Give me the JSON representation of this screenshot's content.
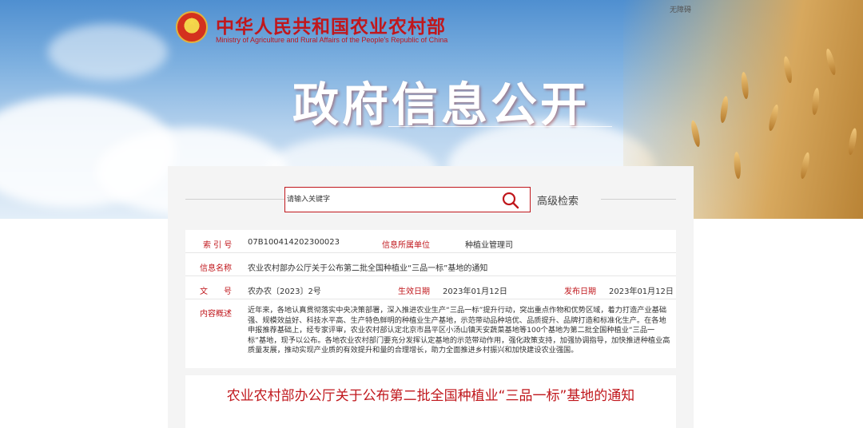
{
  "header": {
    "ministry_cn": "中华人民共和国农业农村部",
    "ministry_en": "Ministry of Agriculture and Rural Affairs of the People's Republic of China",
    "accessibility": "无障碍",
    "hero_title": "政府信息公开"
  },
  "search": {
    "placeholder": "请输入关键字",
    "advanced_label": "高级检索",
    "icon": "search-icon"
  },
  "info": {
    "index_label": "索 引 号",
    "index_value": "07B100414202300023",
    "dept_label": "信息所属单位",
    "dept_value": "种植业管理司",
    "name_label": "信息名称",
    "name_value": "农业农村部办公厅关于公布第二批全国种植业“三品一标”基地的通知",
    "docno_label": "文　　号",
    "docno_value": "农办农〔2023〕2号",
    "effective_label": "生效日期",
    "effective_value": "2023年01月12日",
    "publish_label": "发布日期",
    "publish_value": "2023年01月12日",
    "summary_label": "内容概述",
    "summary_value": "近年来，各地认真贯彻落实中央决策部署，深入推进农业生产“三品一标”提升行动，突出重点作物和优势区域，着力打造产业基础强、规模效益好、科技水平高、生产特色鲜明的种植业生产基地，示范带动品种培优、品质提升、品牌打造和标准化生产。在各地申报推荐基础上，经专家评审，农业农村部认定北京市昌平区小汤山镇天安蔬菜基地等100个基地为第二批全国种植业“三品一标”基地，现予以公布。各地农业农村部门要充分发挥认定基地的示范带动作用，强化政策支持，加强协调指导，加快推进种植业高质量发展，推动实现产业质的有效提升和量的合理增长，助力全面推进乡村振兴和加快建设农业强国。"
  },
  "document": {
    "title": "农业农村部办公厅关于公布第二批全国种植业“三品一标”基地的通知"
  },
  "colors": {
    "accent": "#c0171c",
    "sky": "#7fb1e0",
    "panel": "#f4f4f4"
  }
}
